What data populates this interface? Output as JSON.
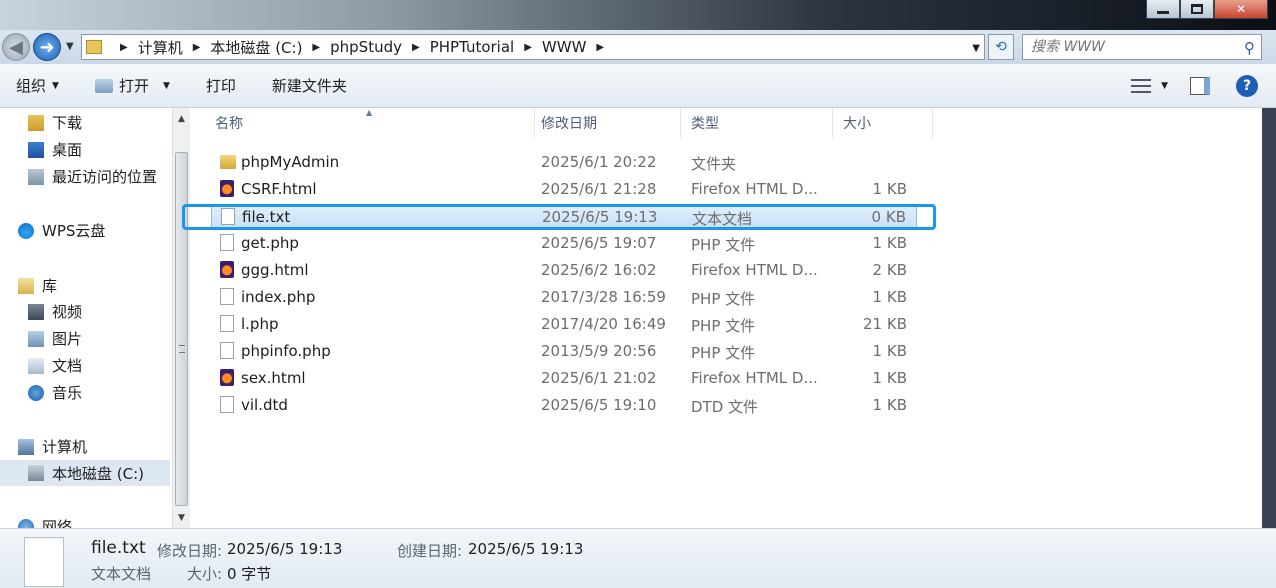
{
  "window": {
    "minimize_label": "",
    "maximize_label": "",
    "close_label": "✕"
  },
  "address": {
    "crumbs": [
      "计算机",
      "本地磁盘 (C:)",
      "phpStudy",
      "PHPTutorial",
      "WWW"
    ]
  },
  "search": {
    "placeholder": "搜索 WWW"
  },
  "toolbar": {
    "organize": "组织",
    "open": "打开",
    "print": "打印",
    "new_folder": "新建文件夹"
  },
  "nav": {
    "downloads": "下载",
    "desktop": "桌面",
    "recent": "最近访问的位置",
    "wps_cloud": "WPS云盘",
    "libraries": "库",
    "videos": "视频",
    "pictures": "图片",
    "documents": "文档",
    "music": "音乐",
    "computer": "计算机",
    "local_disk": "本地磁盘 (C:)",
    "network": "网络"
  },
  "columns": {
    "name": "名称",
    "date": "修改日期",
    "type": "类型",
    "size": "大小"
  },
  "files": [
    {
      "name": "phpMyAdmin",
      "date": "2025/6/1 20:22",
      "type": "文件夹",
      "size": "",
      "icon": "folder-icon"
    },
    {
      "name": "CSRF.html",
      "date": "2025/6/1 21:28",
      "type": "Firefox HTML D...",
      "size": "1 KB",
      "icon": "firefox-html-icon"
    },
    {
      "name": "file.txt",
      "date": "2025/6/5 19:13",
      "type": "文本文档",
      "size": "0 KB",
      "icon": "text-file-icon"
    },
    {
      "name": "get.php",
      "date": "2025/6/5 19:07",
      "type": "PHP 文件",
      "size": "1 KB",
      "icon": "text-file-icon"
    },
    {
      "name": "ggg.html",
      "date": "2025/6/2 16:02",
      "type": "Firefox HTML D...",
      "size": "2 KB",
      "icon": "firefox-html-icon"
    },
    {
      "name": "index.php",
      "date": "2017/3/28 16:59",
      "type": "PHP 文件",
      "size": "1 KB",
      "icon": "text-file-icon"
    },
    {
      "name": "l.php",
      "date": "2017/4/20 16:49",
      "type": "PHP 文件",
      "size": "21 KB",
      "icon": "text-file-icon"
    },
    {
      "name": "phpinfo.php",
      "date": "2013/5/9 20:56",
      "type": "PHP 文件",
      "size": "1 KB",
      "icon": "text-file-icon"
    },
    {
      "name": "sex.html",
      "date": "2025/6/1 21:02",
      "type": "Firefox HTML D...",
      "size": "1 KB",
      "icon": "firefox-html-icon"
    },
    {
      "name": "vil.dtd",
      "date": "2025/6/5 19:10",
      "type": "DTD 文件",
      "size": "1 KB",
      "icon": "text-file-icon"
    }
  ],
  "selected_index": 2,
  "details": {
    "name": "file.txt",
    "type": "文本文档",
    "modified_label": "修改日期:",
    "modified_value": "2025/6/5 19:13",
    "created_label": "创建日期:",
    "created_value": "2025/6/5 19:13",
    "size_label": "大小:",
    "size_value": "0 字节"
  },
  "colors": {
    "selection_outline": "#1a96ee",
    "selection_fill": "#c9e1f8"
  }
}
